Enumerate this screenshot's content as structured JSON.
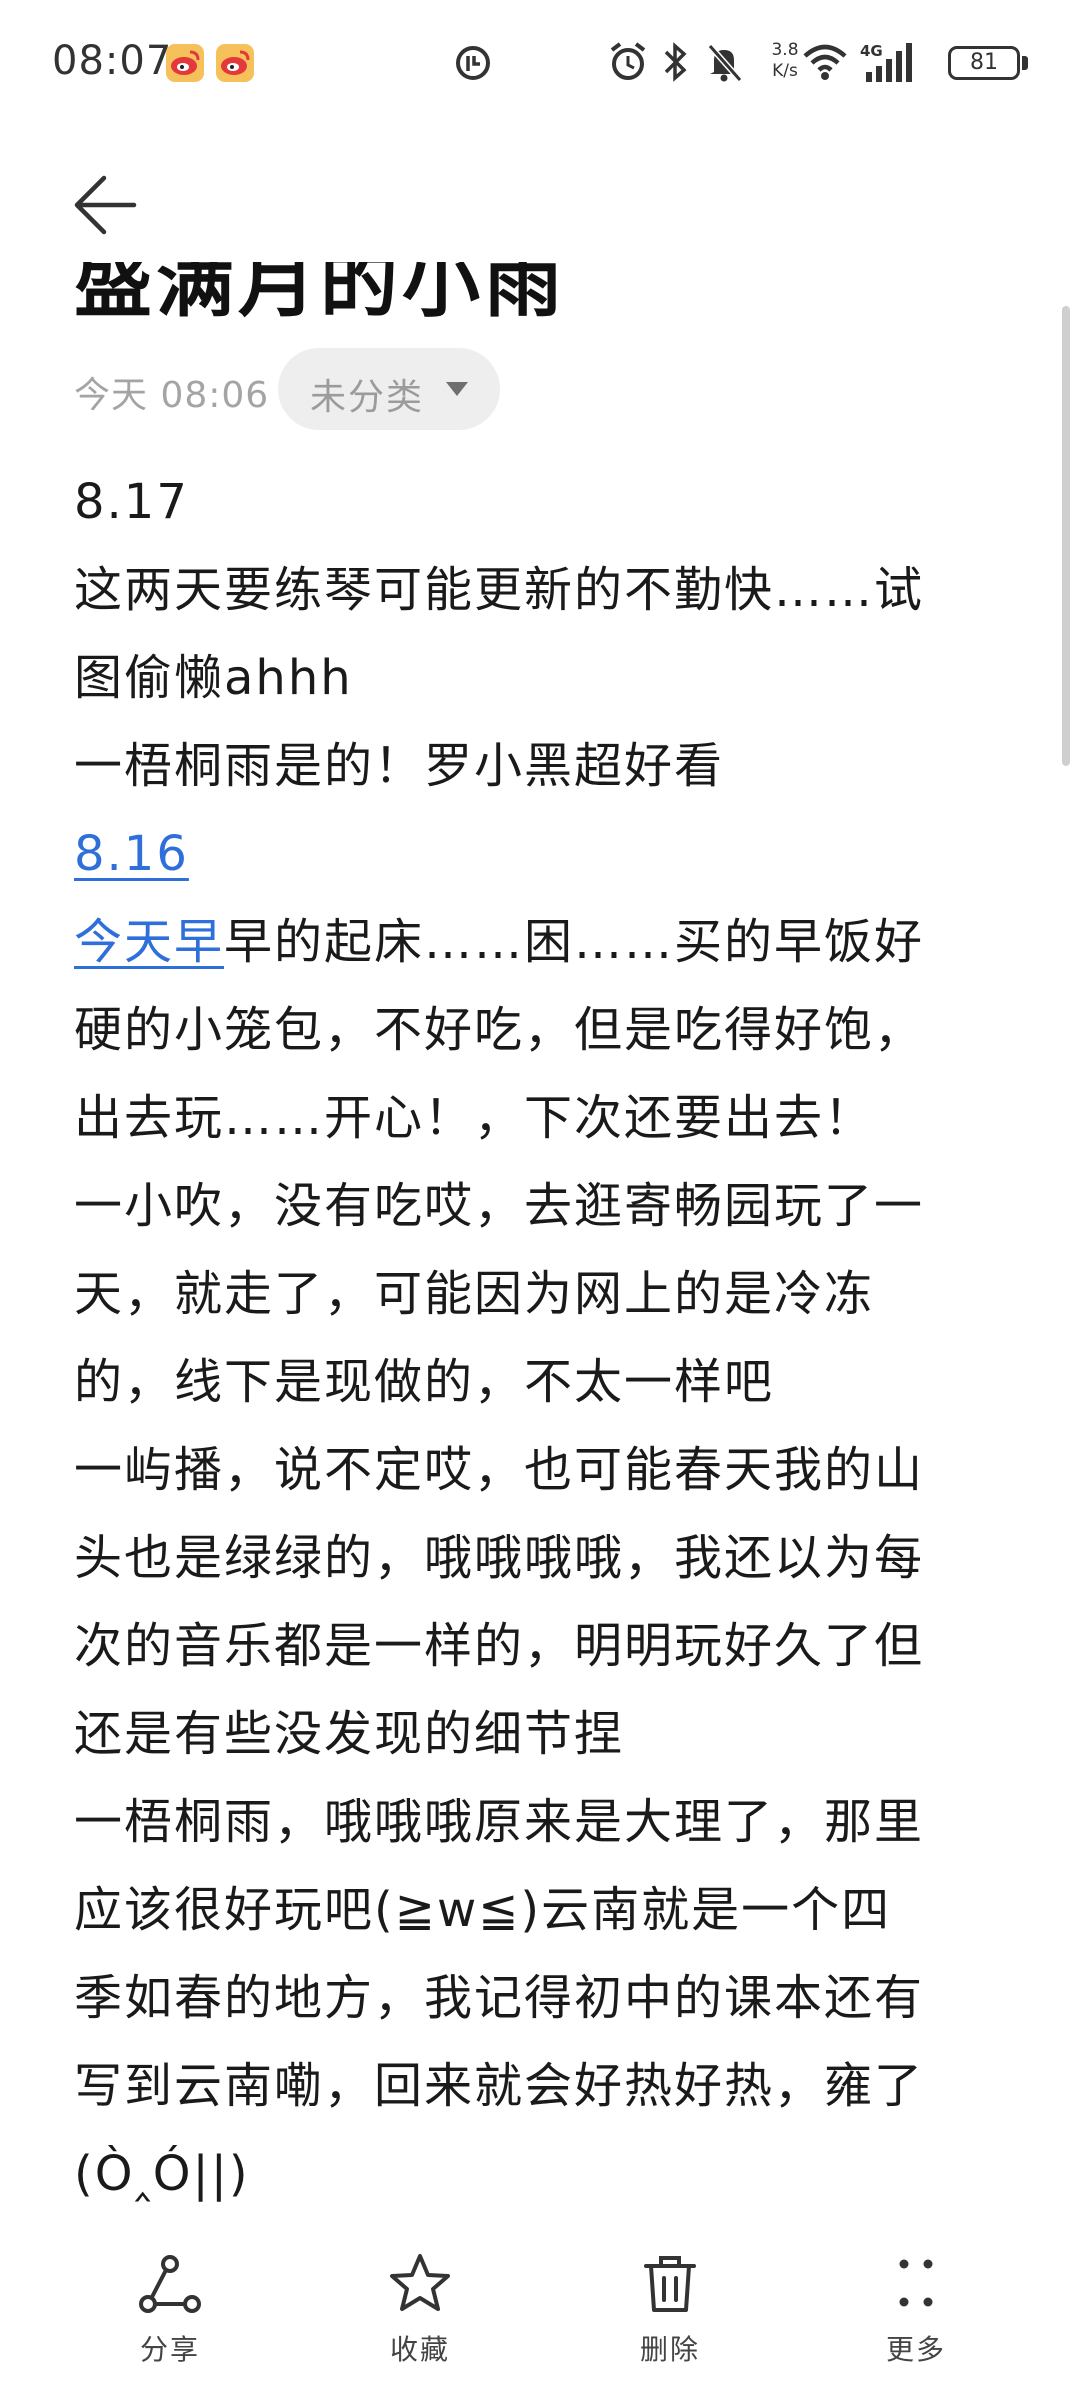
{
  "status_bar": {
    "time": "08:07",
    "net_speed_value": "3.8",
    "net_speed_unit": "K/s",
    "network": "4G",
    "battery": "81"
  },
  "icons": {
    "status_notifications": [
      "weibo-icon",
      "weibo-icon"
    ],
    "status_center": "do-not-disturb-icon",
    "status_right": [
      "alarm-icon",
      "bluetooth-icon",
      "mute-icon",
      "wifi-icon",
      "signal-icon",
      "battery-icon"
    ]
  },
  "header": {
    "title": "盛满月的小雨",
    "date": "今天 08:06",
    "category": "未分类"
  },
  "note": {
    "lines": [
      {
        "text": "8.17"
      },
      {
        "text": "这两天要练琴可能更新的不勤快……试"
      },
      {
        "text": "图偷懒ahhh"
      },
      {
        "text": "一梧桐雨是的！罗小黑超好看"
      },
      {
        "link_text": "8.16"
      },
      {
        "link_text": "今天早",
        "text": "早的起床……困……买的早饭好"
      },
      {
        "text": "硬的小笼包，不好吃，但是吃得好饱，"
      },
      {
        "text": "出去玩……开心！，下次还要出去！"
      },
      {
        "text": "一小吹，没有吃哎，去逛寄畅园玩了一"
      },
      {
        "text": "天，就走了，可能因为网上的是冷冻"
      },
      {
        "text": "的，线下是现做的，不太一样吧"
      },
      {
        "text": "一屿播，说不定哎，也可能春天我的山"
      },
      {
        "text": "头也是绿绿的，哦哦哦哦，我还以为每"
      },
      {
        "text": "次的音乐都是一样的，明明玩好久了但"
      },
      {
        "text": "还是有些没发现的细节捏"
      },
      {
        "text": "一梧桐雨，哦哦哦原来是大理了，那里"
      },
      {
        "text": "应该很好玩吧(≧w≦)云南就是一个四"
      },
      {
        "text": "季如春的地方，我记得初中的课本还有"
      },
      {
        "text": "写到云南嘞，回来就会好热好热，雍了"
      },
      {
        "text": "(Ò‸Ó||)"
      }
    ]
  },
  "toolbar": {
    "share": "分享",
    "favorite": "收藏",
    "delete": "删除",
    "more": "更多"
  },
  "colors": {
    "link": "#2f6fd9",
    "text": "#1a1a1a",
    "muted": "#a4a4a4",
    "chip_bg": "#eeeeee"
  }
}
